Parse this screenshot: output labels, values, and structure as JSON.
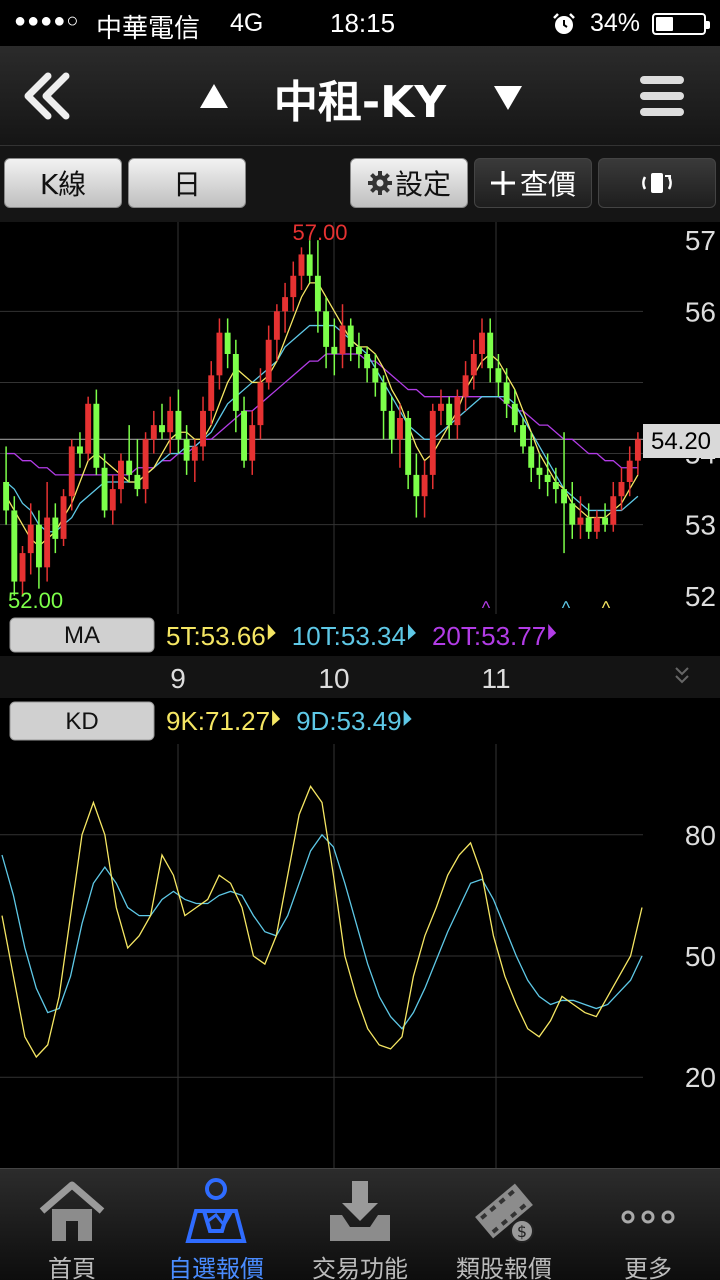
{
  "status_bar": {
    "signal": "●●●●○",
    "carrier": "中華電信",
    "network": "4G",
    "time": "18:15",
    "battery_text": "34%",
    "battery_level": 0.34,
    "alarm_icon": "alarm-clock-icon"
  },
  "nav": {
    "title": "中租-KY",
    "back_icon": "double-chevron-left-icon",
    "prev_icon": "triangle-up-icon",
    "next_icon": "triangle-down-icon",
    "menu_icon": "hamburger-menu-icon"
  },
  "toolbar": {
    "kline_label": "K線",
    "period_label": "日",
    "settings_label": "設定",
    "quote_label": "查價",
    "rotate_icon": "rotate-screen-icon"
  },
  "main_chart": {
    "high_label": "57.00",
    "low_label": "52.00",
    "current_price": "54.20",
    "price_ticks": [
      "57",
      "56",
      "54",
      "53",
      "52"
    ],
    "date_ticks": [
      "9",
      "10",
      "11"
    ],
    "ma_button": "MA",
    "ma_legend": [
      {
        "label": "5T:53.66",
        "color": "#f5e663"
      },
      {
        "label": "10T:53.34",
        "color": "#5ec8e6"
      },
      {
        "label": "20T:53.77",
        "color": "#b23ce6"
      }
    ]
  },
  "kd_chart": {
    "kd_button": "KD",
    "kd_legend": [
      {
        "label": "9K:71.27",
        "color": "#f5e663"
      },
      {
        "label": "9D:53.49",
        "color": "#5ec8e6"
      }
    ],
    "value_ticks": [
      "80",
      "50",
      "20"
    ]
  },
  "tabs": [
    {
      "label": "首頁",
      "icon": "home-icon",
      "active": false
    },
    {
      "label": "自選報價",
      "icon": "watchlist-person-icon",
      "active": true
    },
    {
      "label": "交易功能",
      "icon": "download-tray-icon",
      "active": false
    },
    {
      "label": "類股報價",
      "icon": "film-coin-icon",
      "active": false
    },
    {
      "label": "更多",
      "icon": "more-dots-icon",
      "active": false
    }
  ],
  "chart_data": {
    "type": "candlestick",
    "up_color": "#e63232",
    "down_color": "#7dff4a",
    "ylim": [
      51.8,
      57.2
    ],
    "candles": [
      [
        53.6,
        54.1,
        53.0,
        53.2
      ],
      [
        53.2,
        53.4,
        52.0,
        52.2
      ],
      [
        52.2,
        52.7,
        52.0,
        52.6
      ],
      [
        52.6,
        53.3,
        52.3,
        53.0
      ],
      [
        53.0,
        53.2,
        52.1,
        52.4
      ],
      [
        52.4,
        53.6,
        52.2,
        53.1
      ],
      [
        53.1,
        53.3,
        52.6,
        52.8
      ],
      [
        52.8,
        53.5,
        52.7,
        53.4
      ],
      [
        53.4,
        54.2,
        53.2,
        54.1
      ],
      [
        54.1,
        54.3,
        53.8,
        54.0
      ],
      [
        54.0,
        54.8,
        53.9,
        54.7
      ],
      [
        54.7,
        54.9,
        53.7,
        53.8
      ],
      [
        53.8,
        54.0,
        53.1,
        53.2
      ],
      [
        53.2,
        53.7,
        53.0,
        53.5
      ],
      [
        53.5,
        54.0,
        53.3,
        53.9
      ],
      [
        53.9,
        54.4,
        53.6,
        53.7
      ],
      [
        53.7,
        54.2,
        53.4,
        53.5
      ],
      [
        53.5,
        54.3,
        53.3,
        54.2
      ],
      [
        54.2,
        54.6,
        54.0,
        54.4
      ],
      [
        54.4,
        54.7,
        54.2,
        54.3
      ],
      [
        54.3,
        54.8,
        54.0,
        54.6
      ],
      [
        54.6,
        54.9,
        54.0,
        54.2
      ],
      [
        54.2,
        54.4,
        53.7,
        53.9
      ],
      [
        53.9,
        54.2,
        53.6,
        54.1
      ],
      [
        54.1,
        54.8,
        53.9,
        54.6
      ],
      [
        54.6,
        55.3,
        54.4,
        55.1
      ],
      [
        55.1,
        55.9,
        54.9,
        55.7
      ],
      [
        55.7,
        55.9,
        55.2,
        55.4
      ],
      [
        55.4,
        55.6,
        54.3,
        54.6
      ],
      [
        54.6,
        54.8,
        53.8,
        53.9
      ],
      [
        53.9,
        54.6,
        53.7,
        54.4
      ],
      [
        54.4,
        55.2,
        54.2,
        55.0
      ],
      [
        55.0,
        55.8,
        54.9,
        55.6
      ],
      [
        55.6,
        56.1,
        55.3,
        56.0
      ],
      [
        56.0,
        56.4,
        55.7,
        56.2
      ],
      [
        56.2,
        56.7,
        56.0,
        56.5
      ],
      [
        56.5,
        56.9,
        56.3,
        56.8
      ],
      [
        56.8,
        57.0,
        56.4,
        56.5
      ],
      [
        56.5,
        57.0,
        55.7,
        56.0
      ],
      [
        56.0,
        56.2,
        55.2,
        55.5
      ],
      [
        55.5,
        55.9,
        55.1,
        55.4
      ],
      [
        55.4,
        56.1,
        55.2,
        55.8
      ],
      [
        55.8,
        55.9,
        55.3,
        55.5
      ],
      [
        55.5,
        55.7,
        55.2,
        55.4
      ],
      [
        55.4,
        55.5,
        55.0,
        55.2
      ],
      [
        55.2,
        55.4,
        54.8,
        55.0
      ],
      [
        55.0,
        55.1,
        54.2,
        54.6
      ],
      [
        54.6,
        54.8,
        54.0,
        54.2
      ],
      [
        54.2,
        54.7,
        53.8,
        54.5
      ],
      [
        54.5,
        54.6,
        53.5,
        53.7
      ],
      [
        53.7,
        54.0,
        53.1,
        53.4
      ],
      [
        53.4,
        53.9,
        53.1,
        53.7
      ],
      [
        53.7,
        54.7,
        53.5,
        54.6
      ],
      [
        54.6,
        54.9,
        54.4,
        54.7
      ],
      [
        54.7,
        54.8,
        54.2,
        54.4
      ],
      [
        54.4,
        54.9,
        54.2,
        54.8
      ],
      [
        54.8,
        55.3,
        54.6,
        55.1
      ],
      [
        55.1,
        55.6,
        54.9,
        55.4
      ],
      [
        55.4,
        55.9,
        55.2,
        55.7
      ],
      [
        55.7,
        55.9,
        55.0,
        55.2
      ],
      [
        55.2,
        55.4,
        54.8,
        55.0
      ],
      [
        55.0,
        55.2,
        54.5,
        54.7
      ],
      [
        54.7,
        54.9,
        54.3,
        54.4
      ],
      [
        54.4,
        54.5,
        54.0,
        54.1
      ],
      [
        54.1,
        54.3,
        53.6,
        53.8
      ],
      [
        53.8,
        54.0,
        53.5,
        53.7
      ],
      [
        53.7,
        54.0,
        53.4,
        53.6
      ],
      [
        53.6,
        53.8,
        53.3,
        53.5
      ],
      [
        53.5,
        54.3,
        52.6,
        53.3
      ],
      [
        53.3,
        53.6,
        52.8,
        53.0
      ],
      [
        53.0,
        53.4,
        52.8,
        53.1
      ],
      [
        53.1,
        53.3,
        52.8,
        52.9
      ],
      [
        52.9,
        53.2,
        52.8,
        53.1
      ],
      [
        53.1,
        53.3,
        52.9,
        53.0
      ],
      [
        53.0,
        53.6,
        52.9,
        53.4
      ],
      [
        53.4,
        53.8,
        53.2,
        53.6
      ],
      [
        53.6,
        54.1,
        53.4,
        53.9
      ],
      [
        53.9,
        54.3,
        53.7,
        54.2
      ]
    ],
    "ma5": [
      53.4,
      53.2,
      53.0,
      52.8,
      52.7,
      52.8,
      52.9,
      53.1,
      53.3,
      53.6,
      53.9,
      54.0,
      53.9,
      53.8,
      53.7,
      53.6,
      53.6,
      53.7,
      53.8,
      54.0,
      54.2,
      54.3,
      54.3,
      54.2,
      54.2,
      54.4,
      54.7,
      55.0,
      55.2,
      55.1,
      55.0,
      55.0,
      55.1,
      55.3,
      55.6,
      55.9,
      56.2,
      56.4,
      56.4,
      56.2,
      56.0,
      55.8,
      55.6,
      55.5,
      55.5,
      55.4,
      55.2,
      54.9,
      54.7,
      54.4,
      54.1,
      53.9,
      54.0,
      54.2,
      54.4,
      54.6,
      54.9,
      55.1,
      55.3,
      55.4,
      55.3,
      55.1,
      54.9,
      54.6,
      54.3,
      54.0,
      53.8,
      53.6,
      53.5,
      53.3,
      53.2,
      53.1,
      53.1,
      53.1,
      53.2,
      53.3,
      53.5,
      53.7
    ],
    "ma10": [
      53.6,
      53.5,
      53.3,
      53.2,
      53.0,
      52.9,
      52.9,
      53.0,
      53.1,
      53.3,
      53.4,
      53.5,
      53.6,
      53.6,
      53.6,
      53.6,
      53.6,
      53.7,
      53.8,
      53.9,
      54.0,
      54.0,
      54.1,
      54.1,
      54.2,
      54.3,
      54.5,
      54.7,
      54.8,
      54.9,
      55.0,
      55.1,
      55.2,
      55.3,
      55.5,
      55.6,
      55.7,
      55.8,
      55.8,
      55.8,
      55.8,
      55.7,
      55.6,
      55.5,
      55.4,
      55.2,
      55.0,
      54.8,
      54.6,
      54.4,
      54.3,
      54.2,
      54.2,
      54.3,
      54.4,
      54.5,
      54.6,
      54.7,
      54.8,
      54.8,
      54.8,
      54.8,
      54.7,
      54.5,
      54.3,
      54.1,
      53.9,
      53.7,
      53.5,
      53.4,
      53.3,
      53.2,
      53.2,
      53.2,
      53.2,
      53.2,
      53.3,
      53.4
    ],
    "ma20": [
      54.0,
      54.0,
      53.9,
      53.9,
      53.8,
      53.8,
      53.7,
      53.7,
      53.7,
      53.7,
      53.7,
      53.7,
      53.7,
      53.7,
      53.7,
      53.7,
      53.8,
      53.8,
      53.8,
      53.9,
      53.9,
      54.0,
      54.0,
      54.1,
      54.2,
      54.2,
      54.3,
      54.4,
      54.5,
      54.6,
      54.6,
      54.7,
      54.8,
      54.9,
      55.0,
      55.1,
      55.2,
      55.3,
      55.3,
      55.4,
      55.4,
      55.4,
      55.4,
      55.4,
      55.3,
      55.3,
      55.2,
      55.1,
      55.0,
      54.9,
      54.9,
      54.8,
      54.8,
      54.8,
      54.8,
      54.8,
      54.8,
      54.8,
      54.8,
      54.8,
      54.8,
      54.7,
      54.6,
      54.6,
      54.5,
      54.4,
      54.4,
      54.3,
      54.2,
      54.2,
      54.1,
      54.0,
      54.0,
      53.9,
      53.9,
      53.8,
      53.8,
      53.8
    ],
    "k": [
      60,
      45,
      30,
      25,
      28,
      40,
      60,
      80,
      88,
      80,
      62,
      52,
      55,
      60,
      75,
      70,
      60,
      62,
      64,
      70,
      68,
      62,
      50,
      48,
      55,
      70,
      85,
      92,
      88,
      70,
      50,
      40,
      32,
      28,
      27,
      30,
      45,
      55,
      62,
      70,
      75,
      78,
      70,
      55,
      45,
      38,
      32,
      30,
      34,
      40,
      38,
      36,
      35,
      40,
      45,
      50,
      62
    ],
    "d": [
      75,
      65,
      52,
      42,
      36,
      37,
      45,
      58,
      68,
      72,
      68,
      62,
      60,
      60,
      64,
      66,
      64,
      63,
      63,
      65,
      66,
      65,
      60,
      56,
      55,
      60,
      68,
      76,
      80,
      77,
      68,
      58,
      48,
      40,
      35,
      32,
      36,
      42,
      49,
      56,
      62,
      68,
      69,
      64,
      57,
      50,
      44,
      40,
      38,
      39,
      39,
      38,
      37,
      38,
      41,
      44,
      50
    ]
  }
}
